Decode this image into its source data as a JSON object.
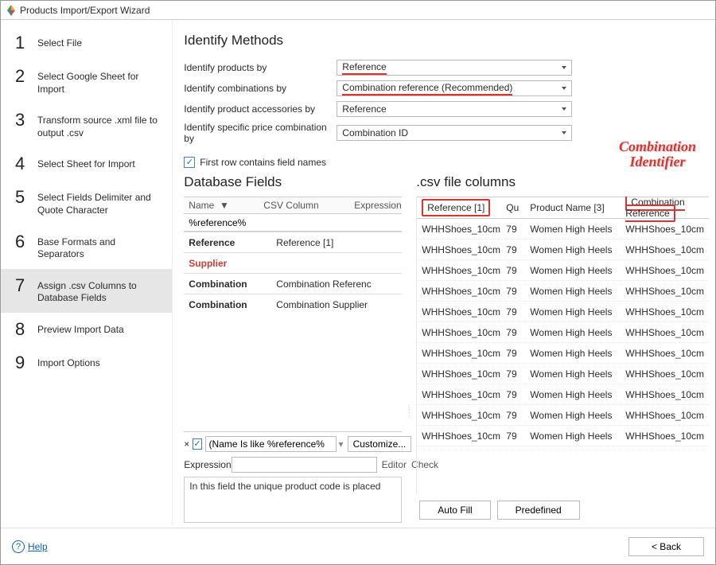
{
  "window_title": "Products Import/Export Wizard",
  "steps": [
    "Select File",
    "Select Google Sheet for Import",
    "Transform source .xml file to output .csv",
    "Select Sheet for Import",
    "Select Fields Delimiter and Quote Character",
    "Base Formats and Separators",
    "Assign .csv Columns to Database Fields",
    "Preview Import Data",
    "Import Options"
  ],
  "main": {
    "section_title": "Identify Methods",
    "form": {
      "identify_products_label": "Identify products by",
      "identify_products_value": "Reference",
      "identify_combinations_label": "Identify combinations by",
      "identify_combinations_value": "Combination reference (Recommended)",
      "identify_accessories_label": "Identify product accessories by",
      "identify_accessories_value": "Reference",
      "identify_price_label": "Identify specific price combination by",
      "identify_price_value": "Combination ID",
      "first_row_label": "First row contains field names"
    },
    "dbfields": {
      "title": "Database Fields",
      "head_name": "Name",
      "head_csv": "CSV Column",
      "head_expr": "Expression",
      "search": "%reference%",
      "rows": [
        {
          "name": "Reference",
          "csv": "Reference [1]",
          "red": false
        },
        {
          "name": "Supplier",
          "csv": "",
          "red": true
        },
        {
          "name": "Combination",
          "csv": "Combination Referenc",
          "red": false
        },
        {
          "name": "Combination",
          "csv": "Combination Supplier",
          "red": false
        }
      ],
      "filter_text": "(Name Is like %reference%",
      "customize_btn": "Customize...",
      "expression_label": "Expression",
      "editor_link": "Editor",
      "check_link": "Check",
      "help_text": "In this field the unique product code is placed"
    },
    "csv": {
      "title": ".csv file columns",
      "annotation_line1": "Combination",
      "annotation_line2": "Identifier",
      "headers": {
        "ref": "Reference [1]",
        "qu": "Qu",
        "name": "Product Name [3]",
        "comb": "Combination Reference"
      },
      "rows": [
        {
          "ref": "WHHShoes_10cm",
          "qu": "79",
          "name": "Women High Heels",
          "comb": "WHHShoes_10cm"
        },
        {
          "ref": "WHHShoes_10cm",
          "qu": "79",
          "name": "Women High Heels",
          "comb": "WHHShoes_10cm"
        },
        {
          "ref": "WHHShoes_10cm",
          "qu": "79",
          "name": "Women High Heels",
          "comb": "WHHShoes_10cm"
        },
        {
          "ref": "WHHShoes_10cm",
          "qu": "79",
          "name": "Women High Heels",
          "comb": "WHHShoes_10cm"
        },
        {
          "ref": "WHHShoes_10cm",
          "qu": "79",
          "name": "Women High Heels",
          "comb": "WHHShoes_10cm"
        },
        {
          "ref": "WHHShoes_10cm",
          "qu": "79",
          "name": "Women High Heels",
          "comb": "WHHShoes_10cm"
        },
        {
          "ref": "WHHShoes_10cm",
          "qu": "79",
          "name": "Women High Heels",
          "comb": "WHHShoes_10cm"
        },
        {
          "ref": "WHHShoes_10cm",
          "qu": "79",
          "name": "Women High Heels",
          "comb": "WHHShoes_10cm"
        },
        {
          "ref": "WHHShoes_10cm",
          "qu": "79",
          "name": "Women High Heels",
          "comb": "WHHShoes_10cm"
        },
        {
          "ref": "WHHShoes_10cm",
          "qu": "79",
          "name": "Women High Heels",
          "comb": "WHHShoes_10cm"
        },
        {
          "ref": "WHHShoes_10cm",
          "qu": "79",
          "name": "Women High Heels",
          "comb": "WHHShoes_10cm"
        }
      ],
      "autofill_btn": "Auto Fill",
      "predefined_btn": "Predefined"
    }
  },
  "footer": {
    "help_label": "Help",
    "back_label": "< Back"
  }
}
